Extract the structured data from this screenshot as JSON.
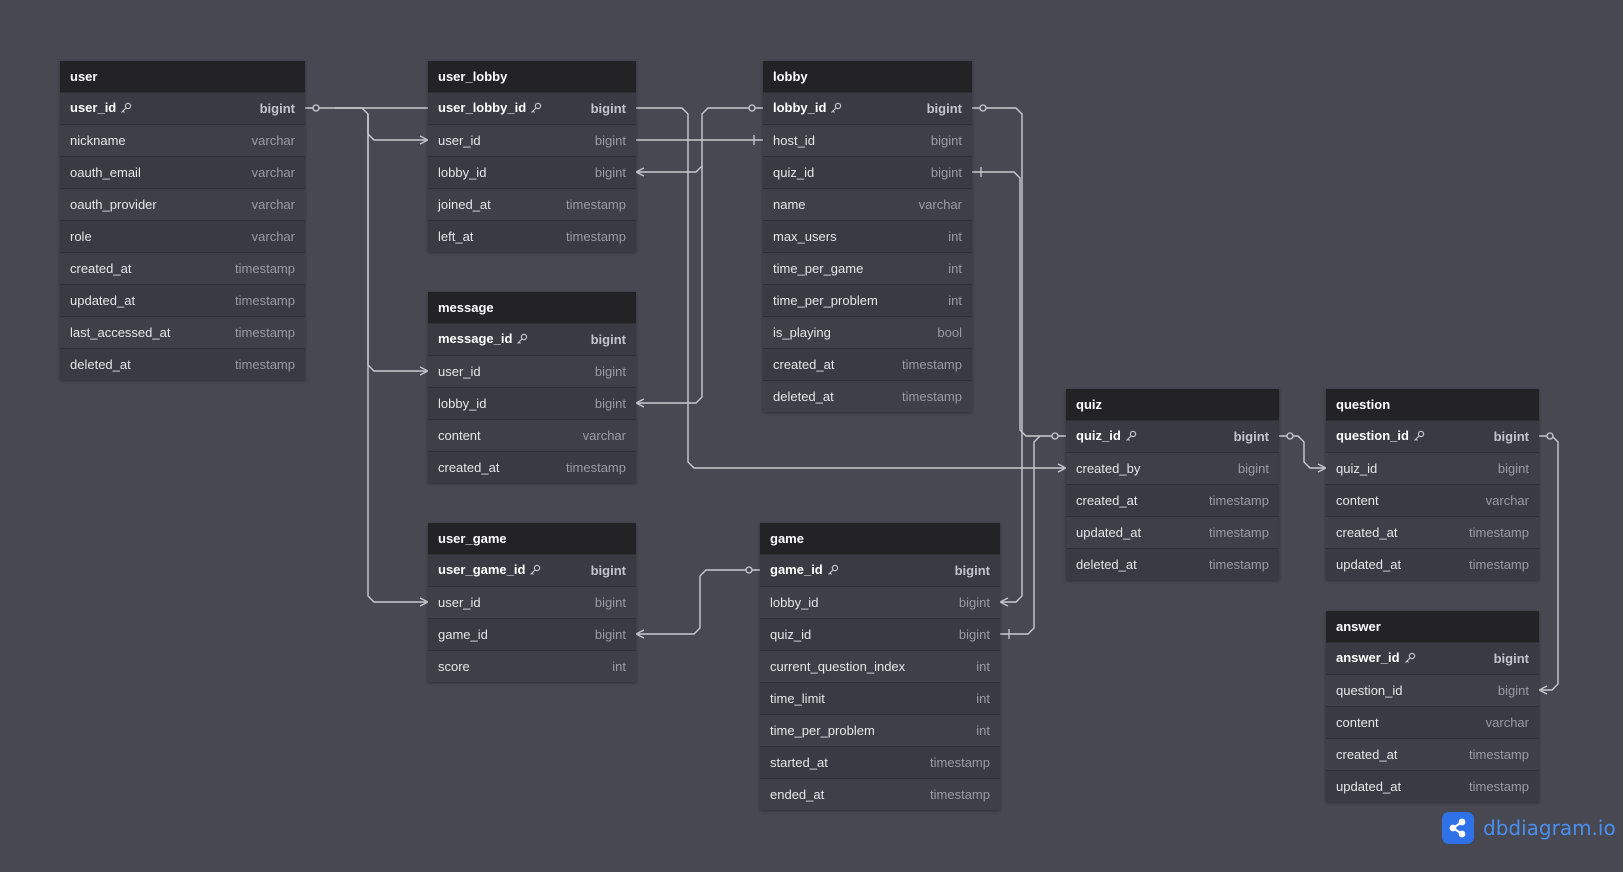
{
  "tables": [
    {
      "name": "user",
      "fields": [
        {
          "name": "user_id",
          "type": "bigint",
          "pk": true
        },
        {
          "name": "nickname",
          "type": "varchar"
        },
        {
          "name": "oauth_email",
          "type": "varchar"
        },
        {
          "name": "oauth_provider",
          "type": "varchar"
        },
        {
          "name": "role",
          "type": "varchar"
        },
        {
          "name": "created_at",
          "type": "timestamp"
        },
        {
          "name": "updated_at",
          "type": "timestamp"
        },
        {
          "name": "last_accessed_at",
          "type": "timestamp"
        },
        {
          "name": "deleted_at",
          "type": "timestamp"
        }
      ]
    },
    {
      "name": "user_lobby",
      "fields": [
        {
          "name": "user_lobby_id",
          "type": "bigint",
          "pk": true
        },
        {
          "name": "user_id",
          "type": "bigint"
        },
        {
          "name": "lobby_id",
          "type": "bigint"
        },
        {
          "name": "joined_at",
          "type": "timestamp"
        },
        {
          "name": "left_at",
          "type": "timestamp"
        }
      ]
    },
    {
      "name": "lobby",
      "fields": [
        {
          "name": "lobby_id",
          "type": "bigint",
          "pk": true
        },
        {
          "name": "host_id",
          "type": "bigint"
        },
        {
          "name": "quiz_id",
          "type": "bigint"
        },
        {
          "name": "name",
          "type": "varchar"
        },
        {
          "name": "max_users",
          "type": "int"
        },
        {
          "name": "time_per_game",
          "type": "int"
        },
        {
          "name": "time_per_problem",
          "type": "int"
        },
        {
          "name": "is_playing",
          "type": "bool"
        },
        {
          "name": "created_at",
          "type": "timestamp"
        },
        {
          "name": "deleted_at",
          "type": "timestamp"
        }
      ]
    },
    {
      "name": "message",
      "fields": [
        {
          "name": "message_id",
          "type": "bigint",
          "pk": true
        },
        {
          "name": "user_id",
          "type": "bigint"
        },
        {
          "name": "lobby_id",
          "type": "bigint"
        },
        {
          "name": "content",
          "type": "varchar"
        },
        {
          "name": "created_at",
          "type": "timestamp"
        }
      ]
    },
    {
      "name": "user_game",
      "fields": [
        {
          "name": "user_game_id",
          "type": "bigint",
          "pk": true
        },
        {
          "name": "user_id",
          "type": "bigint"
        },
        {
          "name": "game_id",
          "type": "bigint"
        },
        {
          "name": "score",
          "type": "int"
        }
      ]
    },
    {
      "name": "game",
      "fields": [
        {
          "name": "game_id",
          "type": "bigint",
          "pk": true
        },
        {
          "name": "lobby_id",
          "type": "bigint"
        },
        {
          "name": "quiz_id",
          "type": "bigint"
        },
        {
          "name": "current_question_index",
          "type": "int"
        },
        {
          "name": "time_limit",
          "type": "int"
        },
        {
          "name": "time_per_problem",
          "type": "int"
        },
        {
          "name": "started_at",
          "type": "timestamp"
        },
        {
          "name": "ended_at",
          "type": "timestamp"
        }
      ]
    },
    {
      "name": "quiz",
      "fields": [
        {
          "name": "quiz_id",
          "type": "bigint",
          "pk": true
        },
        {
          "name": "created_by",
          "type": "bigint"
        },
        {
          "name": "created_at",
          "type": "timestamp"
        },
        {
          "name": "updated_at",
          "type": "timestamp"
        },
        {
          "name": "deleted_at",
          "type": "timestamp"
        }
      ]
    },
    {
      "name": "question",
      "fields": [
        {
          "name": "question_id",
          "type": "bigint",
          "pk": true
        },
        {
          "name": "quiz_id",
          "type": "bigint"
        },
        {
          "name": "content",
          "type": "varchar"
        },
        {
          "name": "created_at",
          "type": "timestamp"
        },
        {
          "name": "updated_at",
          "type": "timestamp"
        }
      ]
    },
    {
      "name": "answer",
      "fields": [
        {
          "name": "answer_id",
          "type": "bigint",
          "pk": true
        },
        {
          "name": "question_id",
          "type": "bigint"
        },
        {
          "name": "content",
          "type": "varchar"
        },
        {
          "name": "created_at",
          "type": "timestamp"
        },
        {
          "name": "updated_at",
          "type": "timestamp"
        }
      ]
    }
  ],
  "relations": [
    {
      "from": "user.user_id",
      "to": "user_lobby.user_id",
      "cardinality": "one-to-many"
    },
    {
      "from": "user.user_id",
      "to": "message.user_id",
      "cardinality": "one-to-many"
    },
    {
      "from": "user.user_id",
      "to": "user_game.user_id",
      "cardinality": "one-to-many"
    },
    {
      "from": "user.user_id",
      "to": "lobby.host_id",
      "cardinality": "one-to-one"
    },
    {
      "from": "user.user_id",
      "to": "quiz.created_by",
      "cardinality": "one-to-many"
    },
    {
      "from": "lobby.lobby_id",
      "to": "user_lobby.lobby_id",
      "cardinality": "one-to-many"
    },
    {
      "from": "lobby.lobby_id",
      "to": "message.lobby_id",
      "cardinality": "one-to-many"
    },
    {
      "from": "lobby.lobby_id",
      "to": "game.lobby_id",
      "cardinality": "one-to-many"
    },
    {
      "from": "quiz.quiz_id",
      "to": "lobby.quiz_id",
      "cardinality": "one-to-one"
    },
    {
      "from": "quiz.quiz_id",
      "to": "game.quiz_id",
      "cardinality": "one-to-one"
    },
    {
      "from": "quiz.quiz_id",
      "to": "question.quiz_id",
      "cardinality": "one-to-many"
    },
    {
      "from": "game.game_id",
      "to": "user_game.game_id",
      "cardinality": "one-to-many"
    },
    {
      "from": "question.question_id",
      "to": "answer.question_id",
      "cardinality": "one-to-many"
    }
  ],
  "colors": {
    "canvas": "#474852",
    "header": "#232325",
    "row": "#393a42",
    "line": "#c9cad0",
    "brand": "#2f72e8"
  },
  "brand": {
    "text": "dbdiagram.io",
    "icon": "share-nodes-icon"
  }
}
